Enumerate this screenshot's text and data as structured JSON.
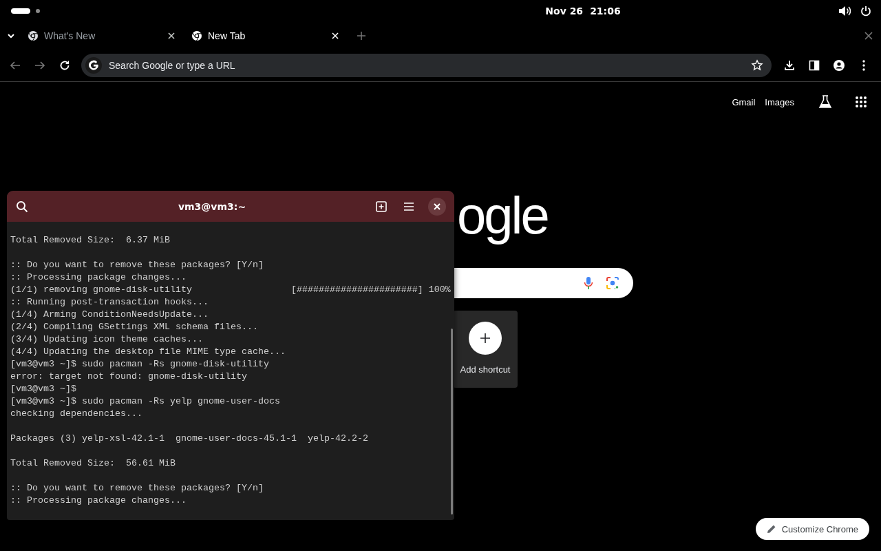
{
  "top_bar": {
    "date": "Nov 26",
    "time": "21:06"
  },
  "browser": {
    "tabs": [
      {
        "title": "What's New",
        "selected": false
      },
      {
        "title": "New Tab",
        "selected": true
      }
    ],
    "address_bar": {
      "placeholder": "Search Google or type a URL"
    },
    "header_links": [
      "Gmail",
      "Images"
    ],
    "logo_visible": "ogle",
    "shortcuts": [
      {
        "label": "Add shortcut"
      }
    ],
    "customize_button": "Customize Chrome"
  },
  "terminal": {
    "title": "vm3@vm3:~",
    "blocks": [
      [
        "Total Removed Size:  6.37 MiB"
      ],
      [
        ":: Do you want to remove these packages? [Y/n]",
        ":: Processing package changes...",
        "(1/1) removing gnome-disk-utility                  [######################] 100%",
        ":: Running post-transaction hooks...",
        "(1/4) Arming ConditionNeedsUpdate...",
        "(2/4) Compiling GSettings XML schema files...",
        "(3/4) Updating icon theme caches...",
        "(4/4) Updating the desktop file MIME type cache...",
        "[vm3@vm3 ~]$ sudo pacman -Rs gnome-disk-utility",
        "error: target not found: gnome-disk-utility",
        "[vm3@vm3 ~]$",
        "[vm3@vm3 ~]$ sudo pacman -Rs yelp gnome-user-docs",
        "checking dependencies..."
      ],
      [
        "Packages (3) yelp-xsl-42.1-1  gnome-user-docs-45.1-1  yelp-42.2-2"
      ],
      [
        "Total Removed Size:  56.61 MiB"
      ],
      [
        ":: Do you want to remove these packages? [Y/n]",
        ":: Processing package changes..."
      ]
    ]
  }
}
